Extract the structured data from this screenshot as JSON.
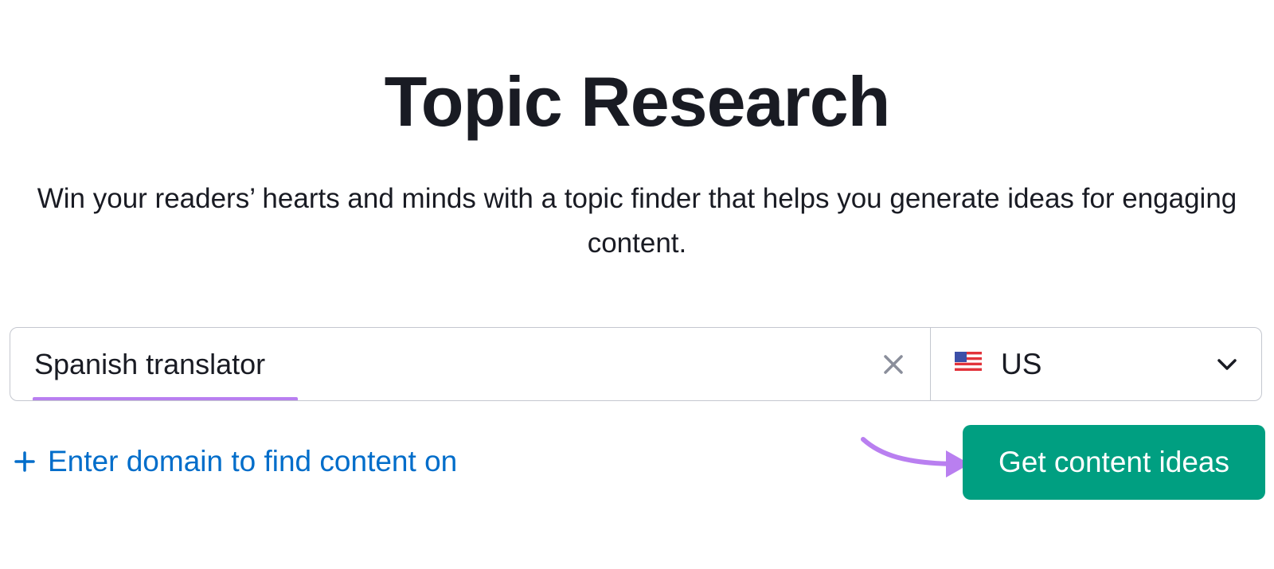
{
  "page": {
    "title": "Topic Research",
    "subtitle": "Win your readers’ hearts and minds with a topic finder that helps you generate ideas for engaging content."
  },
  "search": {
    "value": "Spanish translator",
    "clear_icon": "close-icon"
  },
  "database": {
    "selected": "US",
    "flag_icon": "us-flag-icon",
    "dropdown_icon": "chevron-down-icon"
  },
  "domain_link": {
    "icon": "plus-icon",
    "label": "Enter domain to find content on"
  },
  "cta": {
    "label": "Get content ideas",
    "pointer_icon": "arrow-icon"
  },
  "colors": {
    "text": "#191b23",
    "link": "#006dca",
    "button": "#009f81",
    "button_text": "#ffffff",
    "highlight": "#b97ff0",
    "border": "#c4c7cf"
  }
}
